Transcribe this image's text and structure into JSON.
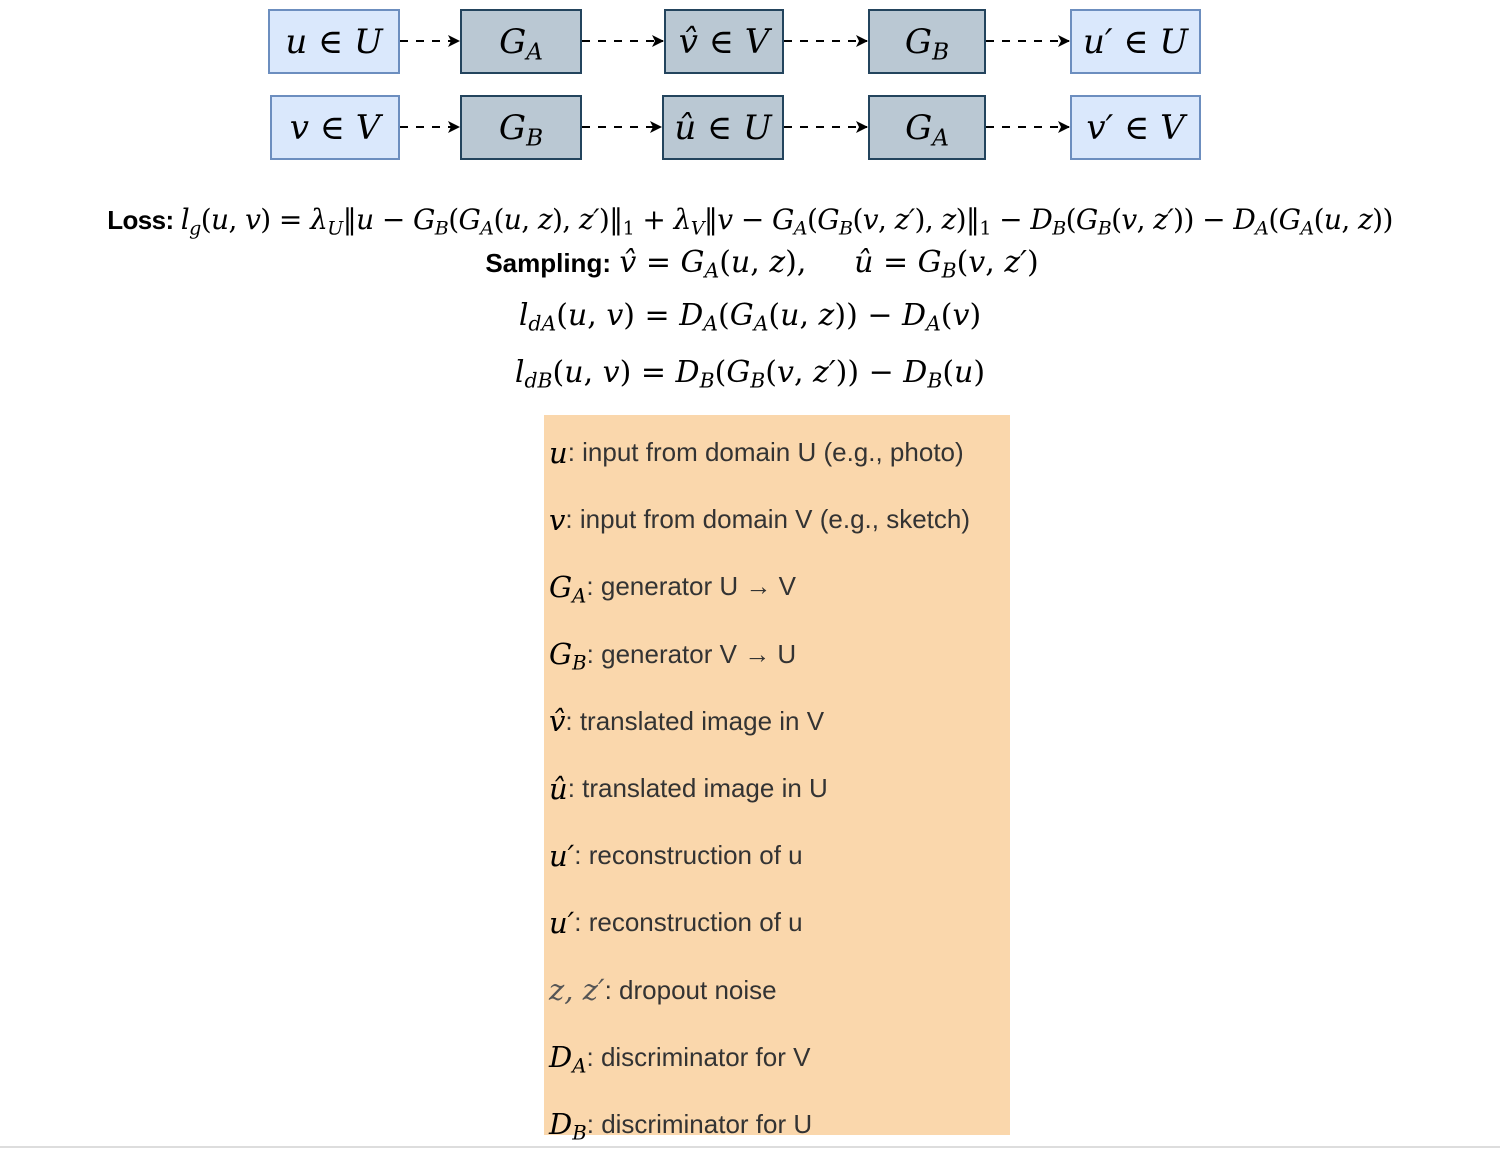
{
  "diagram": {
    "row1": [
      "u ∈ U",
      "G_A",
      "v̂ ∈ V",
      "G_B",
      "u′ ∈ U"
    ],
    "row2": [
      "v ∈ V",
      "G_B",
      "û ∈ U",
      "G_A",
      "v′ ∈ V"
    ],
    "colors": {
      "io_fill": "#dae8fc",
      "io_stroke": "#6c8ebf",
      "net_fill": "#bac8d3",
      "net_stroke": "#23445d"
    }
  },
  "equations": {
    "loss_label": "Loss:",
    "loss": "l_g(u, v) = λ_U‖u − G_B(G_A(u, z), z′)‖_1 + λ_V‖v − G_A(G_B(v, z′), z)‖_1 − D_B(G_B(v, z′)) − D_A(G_A(u, z))",
    "sampling_label": "Sampling:",
    "sampling": "v̂ = G_A(u, z),     û = G_B(v, z′)",
    "lda": "l_dA(u, v) = D_A(G_A(u, z)) − D_A(v)",
    "ldb": "l_dB(u, v) = D_B(G_B(v, z′)) − D_B(u)"
  },
  "legend": {
    "background": "#fad7ac",
    "items": [
      {
        "symbol": "u",
        "text": ": input from domain U (e.g., photo)"
      },
      {
        "symbol": "v",
        "text": ": input from domain V (e.g., sketch)"
      },
      {
        "symbol": "G_A",
        "text": ": generator U → V"
      },
      {
        "symbol": "G_B",
        "text": ": generator V → U"
      },
      {
        "symbol": "v̂",
        "text": ": translated image in V"
      },
      {
        "symbol": "û",
        "text": ": translated image in U"
      },
      {
        "symbol": "u′",
        "text": ": reconstruction of u"
      },
      {
        "symbol": "u′",
        "text": ": reconstruction of u"
      },
      {
        "symbol": "z, z′",
        "text": ": dropout noise"
      },
      {
        "symbol": "D_A",
        "text": ": discriminator for V"
      },
      {
        "symbol": "D_B",
        "text": ": discriminator for U"
      }
    ]
  }
}
